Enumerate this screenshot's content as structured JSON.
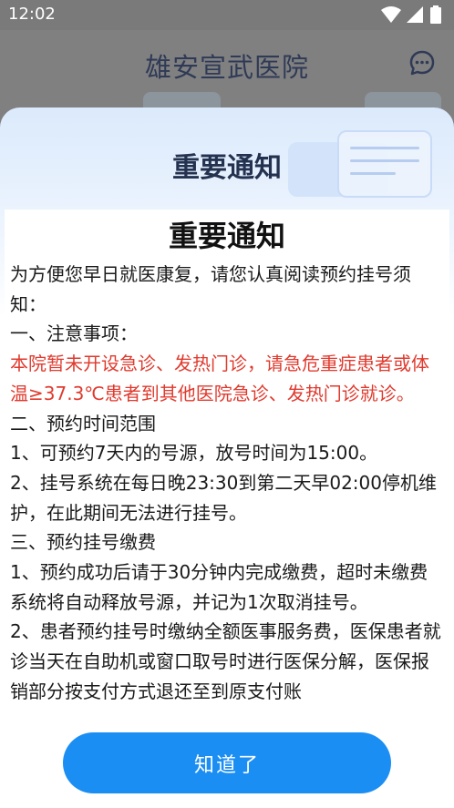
{
  "status_bar": {
    "time": "12:02",
    "icons": [
      "wifi-icon",
      "signal-icon",
      "battery-icon"
    ]
  },
  "app": {
    "title": "雄安宣武医院",
    "header_icon": "message-icon"
  },
  "modal": {
    "title": "重要通知",
    "notice_heading": "重要通知",
    "paragraphs": [
      {
        "text": "为方便您早日就医康复，请您认真阅读预约挂号须知："
      },
      {
        "text": "一、注意事项："
      },
      {
        "text": "本院暂未开设急诊、发热门诊，请急危重症患者或体温≥37.3℃患者到其他医院急诊、发热门诊就诊。",
        "highlight": true
      },
      {
        "text": "二、预约时间范围"
      },
      {
        "text": "1、可预约7天内的号源，放号时间为15:00。"
      },
      {
        "text": "2、挂号系统在每日晚23:30到第二天早02:00停机维护，在此期间无法进行挂号。"
      },
      {
        "text": "三、预约挂号缴费"
      },
      {
        "text": "1、预约成功后请于30分钟内完成缴费，超时未缴费系统将自动释放号源，并记为1次取消挂号。"
      },
      {
        "text": "2、患者预约挂号时缴纳全额医事服务费，医保患者就诊当天在自助机或窗口取号时进行医保分解，医保报销部分按支付方式退还至到原支付账"
      }
    ],
    "confirm_label": "知道了"
  },
  "colors": {
    "accent": "#1b8ef4",
    "warning_text": "#e03a2e",
    "title_text": "#24324f"
  }
}
